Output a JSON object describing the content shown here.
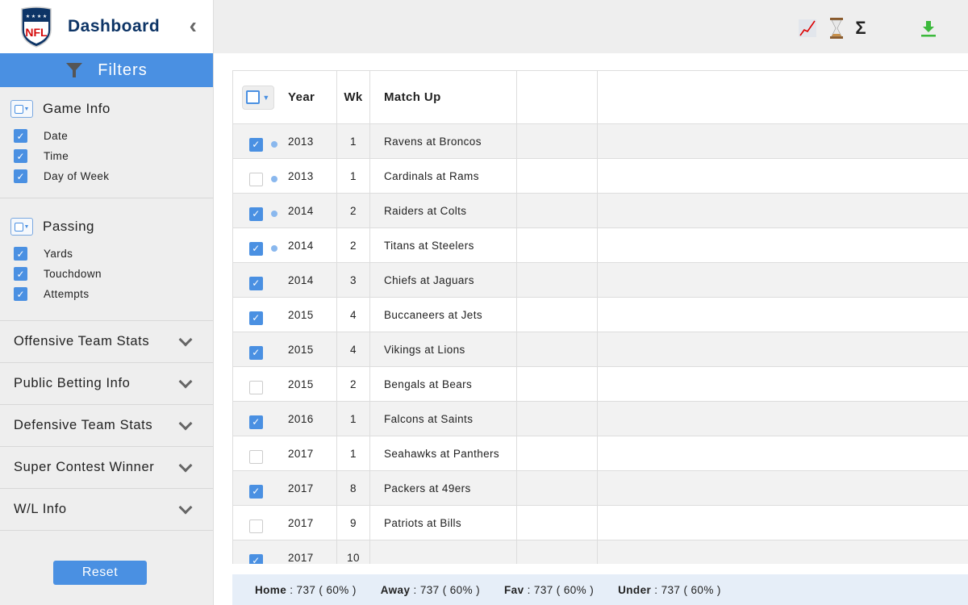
{
  "app": {
    "title": "Dashboard",
    "logo": "NFL"
  },
  "sidebar": {
    "filters_label": "Filters",
    "groups": [
      {
        "title": "Game Info",
        "options": [
          {
            "label": "Date",
            "checked": true
          },
          {
            "label": "Time",
            "checked": true
          },
          {
            "label": "Day of Week",
            "checked": true
          }
        ]
      },
      {
        "title": "Passing",
        "options": [
          {
            "label": "Yards",
            "checked": true
          },
          {
            "label": "Touchdown",
            "checked": true
          },
          {
            "label": "Attempts",
            "checked": true
          }
        ]
      }
    ],
    "accordions": [
      "Offensive Team Stats",
      "Public Betting Info",
      "Defensive Team Stats",
      "Super Contest Winner",
      "W/L Info"
    ],
    "reset_label": "Reset"
  },
  "toolbar": {
    "icons": [
      "chart-icon",
      "hourglass-icon",
      "sigma-icon",
      "download-icon"
    ],
    "sigma": "Σ"
  },
  "table": {
    "headers": [
      "Year",
      "Wk",
      "Match Up",
      "",
      ""
    ],
    "rows": [
      {
        "checked": true,
        "dot": true,
        "year": "2013",
        "wk": "1",
        "match": "Ravens at Broncos"
      },
      {
        "checked": false,
        "dot": true,
        "year": "2013",
        "wk": "1",
        "match": "Cardinals at Rams"
      },
      {
        "checked": true,
        "dot": true,
        "year": "2014",
        "wk": "2",
        "match": "Raiders at Colts"
      },
      {
        "checked": true,
        "dot": true,
        "year": "2014",
        "wk": "2",
        "match": "Titans at Steelers"
      },
      {
        "checked": true,
        "dot": false,
        "year": "2014",
        "wk": "3",
        "match": "Chiefs at Jaguars"
      },
      {
        "checked": true,
        "dot": false,
        "year": "2015",
        "wk": "4",
        "match": "Buccaneers at Jets"
      },
      {
        "checked": true,
        "dot": false,
        "year": "2015",
        "wk": "4",
        "match": "Vikings at Lions"
      },
      {
        "checked": false,
        "dot": false,
        "year": "2015",
        "wk": "2",
        "match": "Bengals at Bears"
      },
      {
        "checked": true,
        "dot": false,
        "year": "2016",
        "wk": "1",
        "match": "Falcons at Saints"
      },
      {
        "checked": false,
        "dot": false,
        "year": "2017",
        "wk": "1",
        "match": "Seahawks at Panthers"
      },
      {
        "checked": true,
        "dot": false,
        "year": "2017",
        "wk": "8",
        "match": "Packers at 49ers"
      },
      {
        "checked": false,
        "dot": false,
        "year": "2017",
        "wk": "9",
        "match": "Patriots at Bills"
      },
      {
        "checked": true,
        "dot": false,
        "year": "2017",
        "wk": "10",
        "match": ""
      }
    ]
  },
  "footer": [
    {
      "label": "Home",
      "value": " : 737 ( 60% )"
    },
    {
      "label": "Away",
      "value": " : 737 ( 60% )"
    },
    {
      "label": "Fav",
      "value": " : 737 ( 60% )"
    },
    {
      "label": "Under",
      "value": " : 737 ( 60% )"
    }
  ],
  "colors": {
    "accent": "#4a90e2",
    "brand": "#0d3466",
    "download": "#3cb93c"
  }
}
